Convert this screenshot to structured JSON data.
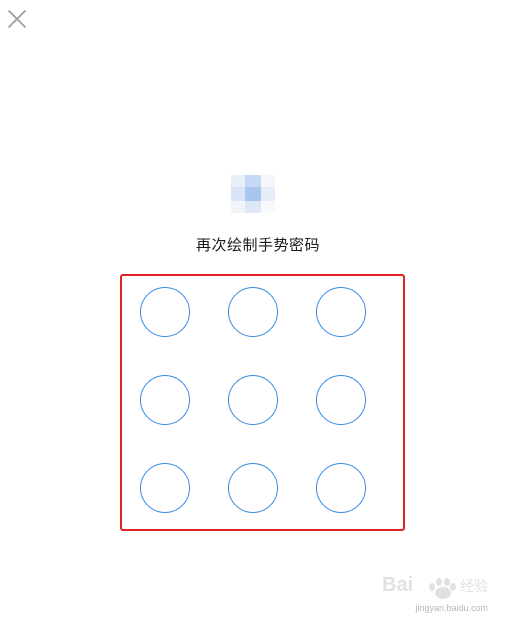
{
  "header": {
    "close_icon": "close-icon"
  },
  "avatar": {
    "icon": "user-avatar-pixelated"
  },
  "prompt": {
    "title": "再次绘制手势密码"
  },
  "gesture_pad": {
    "rows": 3,
    "cols": 3,
    "highlight_color": "#e32323",
    "dot_color": "#3a8ce0"
  },
  "watermark": {
    "text": "jingyan.baidu.com"
  }
}
